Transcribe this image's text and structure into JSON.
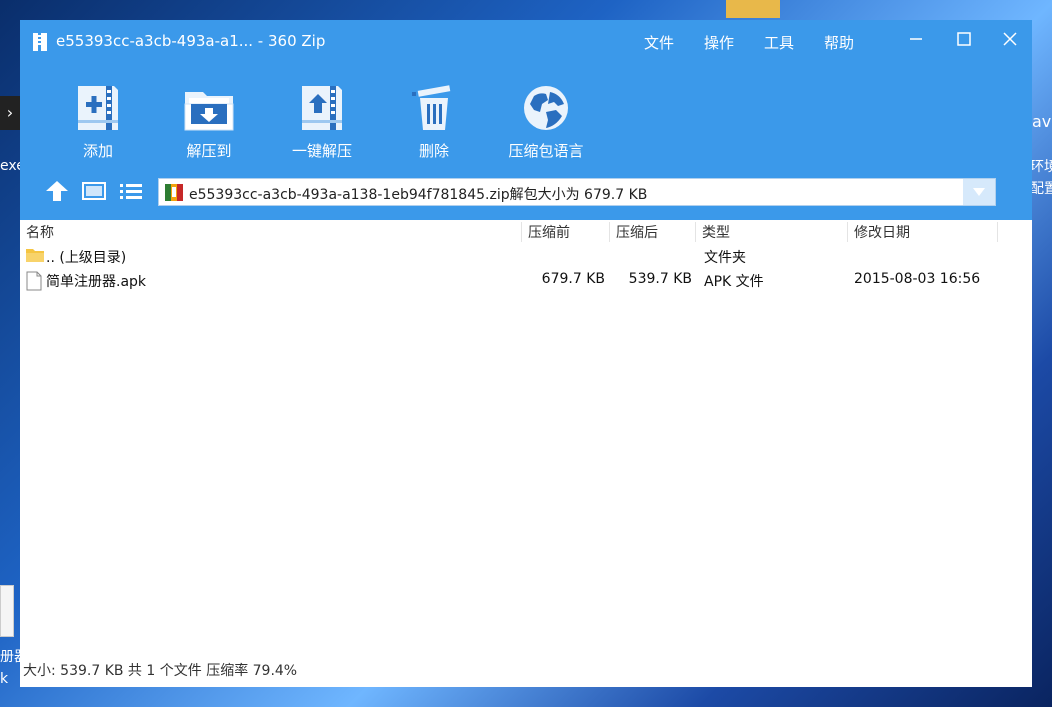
{
  "window": {
    "title": "e55393cc-a3cb-493a-a1... - 360 Zip",
    "menu": [
      "文件",
      "操作",
      "工具",
      "帮助"
    ]
  },
  "toolbar": {
    "add": "添加",
    "extract_to": "解压到",
    "one_click_extract": "一键解压",
    "delete": "删除",
    "language": "压缩包语言"
  },
  "address": {
    "text": "e55393cc-a3cb-493a-a138-1eb94f781845.zip解包大小为 679.7 KB"
  },
  "columns": {
    "name": "名称",
    "compressed_before": "压缩前",
    "compressed_after": "压缩后",
    "type": "类型",
    "modified": "修改日期"
  },
  "rows": [
    {
      "name": ".. (上级目录)",
      "before": "",
      "after": "",
      "type": "文件夹",
      "modified": "",
      "icon": "folder-icon"
    },
    {
      "name": "简单注册器.apk",
      "before": "679.7 KB",
      "after": "539.7 KB",
      "type": "APK 文件",
      "modified": "2015-08-03 16:56",
      "icon": "file-icon"
    }
  ],
  "status": {
    "text": "大小: 539.7 KB 共 1 个文件 压缩率 79.4%"
  },
  "desktop": {
    "left_label": "exe",
    "right_label1": "ava",
    "right_label2": "环境\n配置",
    "left_label2": "册器\nk"
  },
  "colors": {
    "header_bg": "#3b99ea",
    "window_bg": "#ffffff"
  }
}
